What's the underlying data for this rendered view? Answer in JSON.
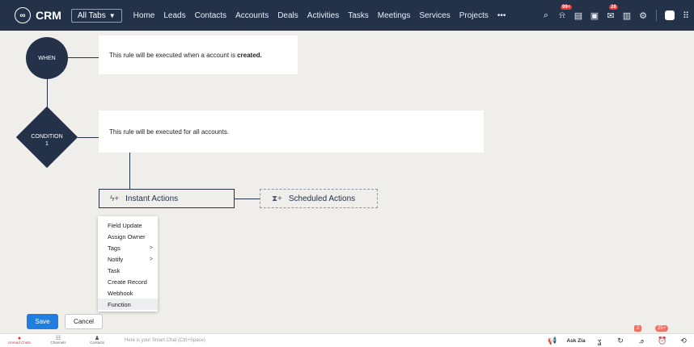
{
  "nav": {
    "logo": "CRM",
    "all_tabs": "All Tabs",
    "items": [
      "Home",
      "Leads",
      "Contacts",
      "Accounts",
      "Deals",
      "Activities",
      "Tasks",
      "Meetings",
      "Services",
      "Projects",
      "•••"
    ],
    "notification_badge": "99+",
    "mail_badge": "28"
  },
  "flow": {
    "when_label": "WHEN",
    "when_text": "This rule will be executed when a account is",
    "when_text_bold": "created.",
    "condition_label": "CONDITION",
    "condition_number": "1",
    "condition_text": "This rule will be executed for all accounts.",
    "instant_actions": "Instant Actions",
    "scheduled_actions": "Scheduled Actions"
  },
  "menu": {
    "items": [
      {
        "label": "Field Update",
        "submenu": false
      },
      {
        "label": "Assign Owner",
        "submenu": false
      },
      {
        "label": "Tags",
        "submenu": true
      },
      {
        "label": "Notify",
        "submenu": true
      },
      {
        "label": "Task",
        "submenu": false
      },
      {
        "label": "Create Record",
        "submenu": false
      },
      {
        "label": "Webhook",
        "submenu": false
      },
      {
        "label": "Function",
        "submenu": false
      }
    ],
    "submenu_arrow": ">"
  },
  "buttons": {
    "save": "Save",
    "cancel": "Cancel"
  },
  "footer": {
    "unread_chats": "Unread Chats",
    "unread_badge": "1",
    "channels": "Channels",
    "contacts": "Contacts",
    "chat_placeholder": "Here is your Smart Chat (Ctrl+Space)",
    "ask_zia": "Ask Zia",
    "badge_2": "2",
    "badge_25": "25+"
  },
  "colors": {
    "nav_bg": "#233249",
    "canvas_bg": "#efeeea",
    "primary": "#1f7ee0",
    "badge": "#e53b3b"
  }
}
